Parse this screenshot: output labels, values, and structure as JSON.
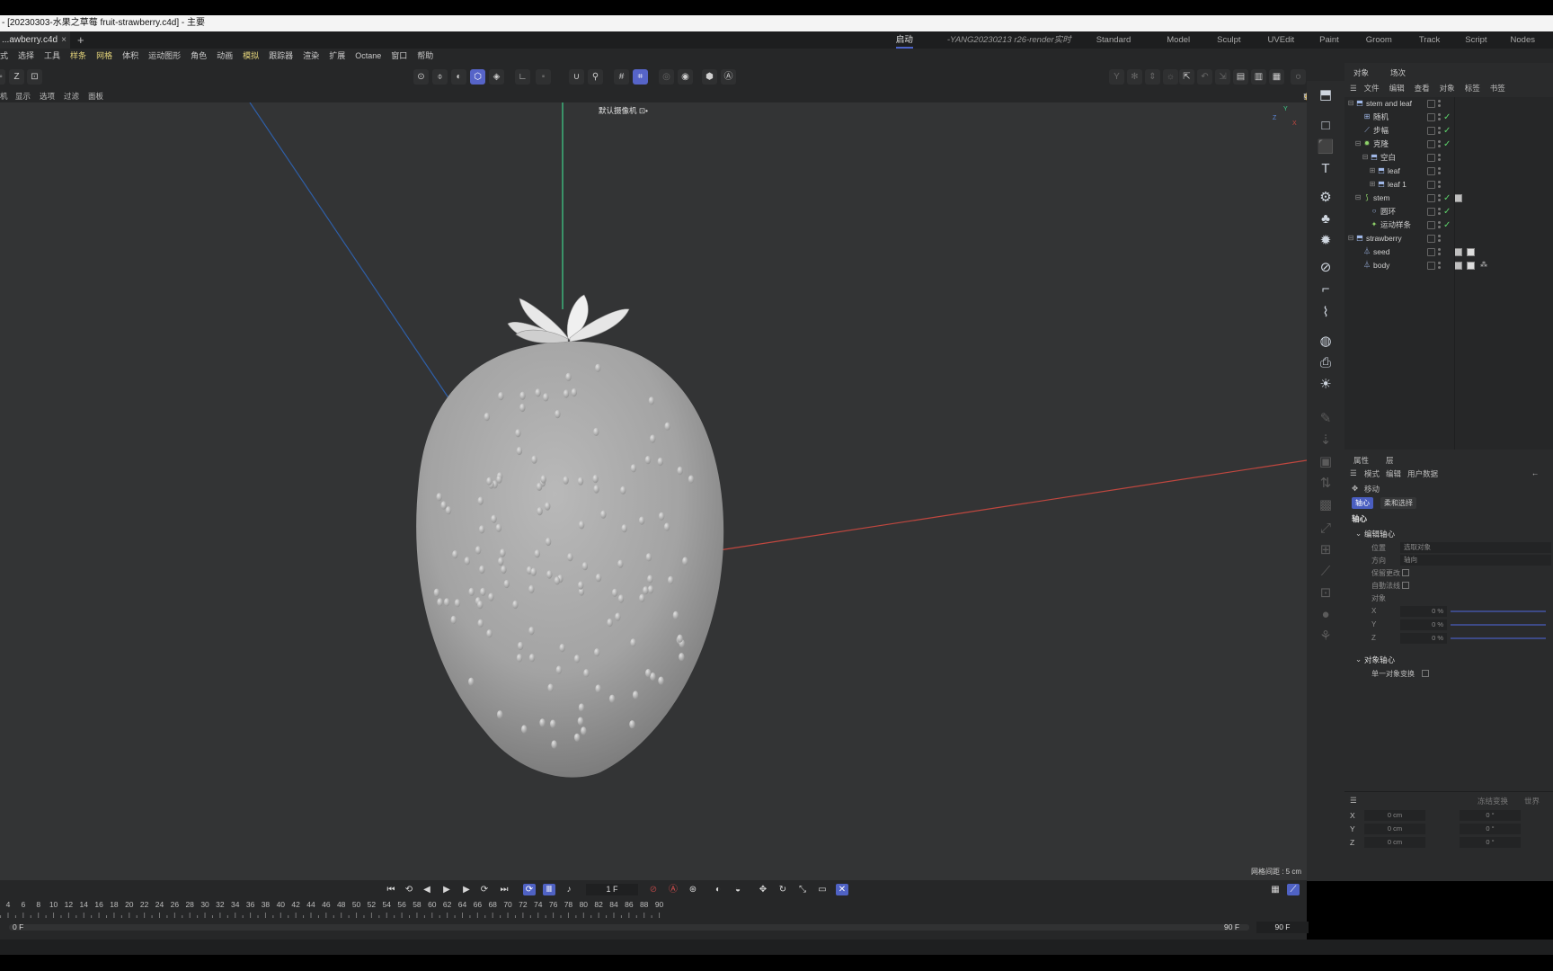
{
  "window": {
    "title": "- [20230303-水果之草莓 fruit-strawberry.c4d] - 主要"
  },
  "tabs": {
    "doc_tab": "...awberry.c4d",
    "close": "×",
    "add": "+"
  },
  "layouts": [
    "启动",
    "-YANG20230213 r26-render实时",
    "Standard",
    "Model",
    "Sculpt",
    "UVEdit",
    "Paint",
    "Groom",
    "Track",
    "Script",
    "Nodes"
  ],
  "menu": [
    "式",
    "选择",
    "工具",
    "样条",
    "网格",
    "体积",
    "运动图形",
    "角色",
    "动画",
    "模拟",
    "跟踪器",
    "渲染",
    "扩展",
    "Octane",
    "窗口",
    "帮助"
  ],
  "view_menu": [
    "机",
    "显示",
    "选项",
    "过滤",
    "面板"
  ],
  "viewport": {
    "camera_label": "默认摄像机 ⊡•",
    "grid_spacing": "网格间距 : 5 cm",
    "axis_y": "Y",
    "axis_x": "X",
    "axis_z": "Z"
  },
  "object_manager": {
    "tabs": [
      "对象",
      "场次"
    ],
    "menu": [
      "文件",
      "编辑",
      "查看",
      "对象",
      "标签",
      "书签"
    ],
    "rows": [
      {
        "name": "stem and leaf",
        "check": ""
      },
      {
        "name": "随机",
        "check": "✓"
      },
      {
        "name": "步幅",
        "check": "✓"
      },
      {
        "name": "克隆",
        "check": "✓"
      },
      {
        "name": "空白",
        "check": ""
      },
      {
        "name": "leaf",
        "check": ""
      },
      {
        "name": "leaf 1",
        "check": ""
      },
      {
        "name": "stem",
        "check": "✓"
      },
      {
        "name": "圆环",
        "check": "✓"
      },
      {
        "name": "运动样条",
        "check": "✓"
      },
      {
        "name": "strawberry",
        "check": ""
      },
      {
        "name": "seed",
        "check": ""
      },
      {
        "name": "body",
        "check": ""
      }
    ]
  },
  "attributes": {
    "tabs": [
      "属性",
      "层"
    ],
    "menu": [
      "模式",
      "编辑",
      "用户数据"
    ],
    "tool": "移动",
    "chips": [
      "轴心",
      "柔和选择"
    ],
    "section": "轴心",
    "group1": "编辑轴心",
    "position_label": "位置",
    "position_value": "选取对象",
    "direction_label": "方向",
    "direction_value": "轴向",
    "keep_changes": "保留更改",
    "auto_normals": "自動法线",
    "object_label": "对象",
    "x_label": "X",
    "x_value": "0 %",
    "y_label": "Y",
    "y_value": "0 %",
    "z_label": "Z",
    "z_value": "0 %",
    "group2": "对象轴心",
    "single_object": "单一对象变换"
  },
  "coords": {
    "btn_apply": "冻结变换",
    "btn_world": "世界",
    "rows": [
      {
        "axis": "X",
        "pos": "0 cm",
        "rot": "0 °"
      },
      {
        "axis": "Y",
        "pos": "0 cm",
        "rot": "0 °"
      },
      {
        "axis": "Z",
        "pos": "0 cm",
        "rot": "0 °"
      }
    ]
  },
  "timeline": {
    "current_frame": "1 F",
    "start": "0 F",
    "end_a": "90 F",
    "end_b": "90 F",
    "ticks": [
      "4",
      "6",
      "8",
      "10",
      "12",
      "14",
      "16",
      "18",
      "20",
      "22",
      "24",
      "26",
      "28",
      "30",
      "32",
      "34",
      "36",
      "38",
      "40",
      "42",
      "44",
      "46",
      "48",
      "50",
      "52",
      "54",
      "56",
      "58",
      "60",
      "62",
      "64",
      "66",
      "68",
      "70",
      "72",
      "74",
      "76",
      "78",
      "80",
      "82",
      "84",
      "86",
      "88",
      "90"
    ]
  },
  "colors": {
    "accent": "#5664c8",
    "check_green": "#5dd16a",
    "axis_x": "#c0473f",
    "axis_y": "#3fd08a",
    "axis_z": "#2f5fa8",
    "viewport_bg": "#333435"
  }
}
